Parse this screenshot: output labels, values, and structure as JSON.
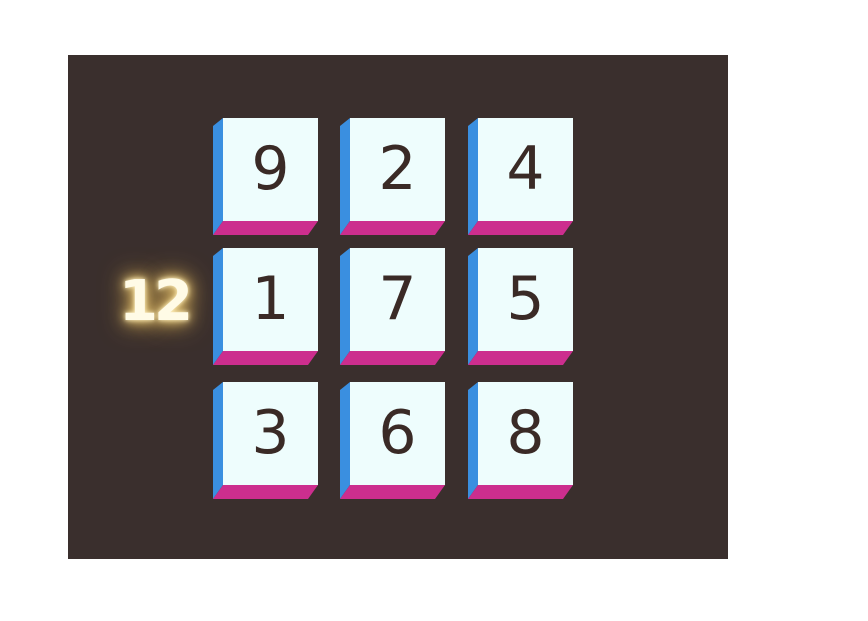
{
  "game": {
    "row_sum": "12",
    "tiles": [
      [
        "9",
        "2",
        "4"
      ],
      [
        "1",
        "7",
        "5"
      ],
      [
        "3",
        "6",
        "8"
      ]
    ],
    "colors": {
      "board": "#3a2f2d",
      "tile_face": "#eefdfd",
      "tile_left_edge": "#3a8fe0",
      "tile_bottom_edge": "#cc2e8e",
      "digit": "#3a2a26",
      "glow": "#f5d98c"
    }
  }
}
